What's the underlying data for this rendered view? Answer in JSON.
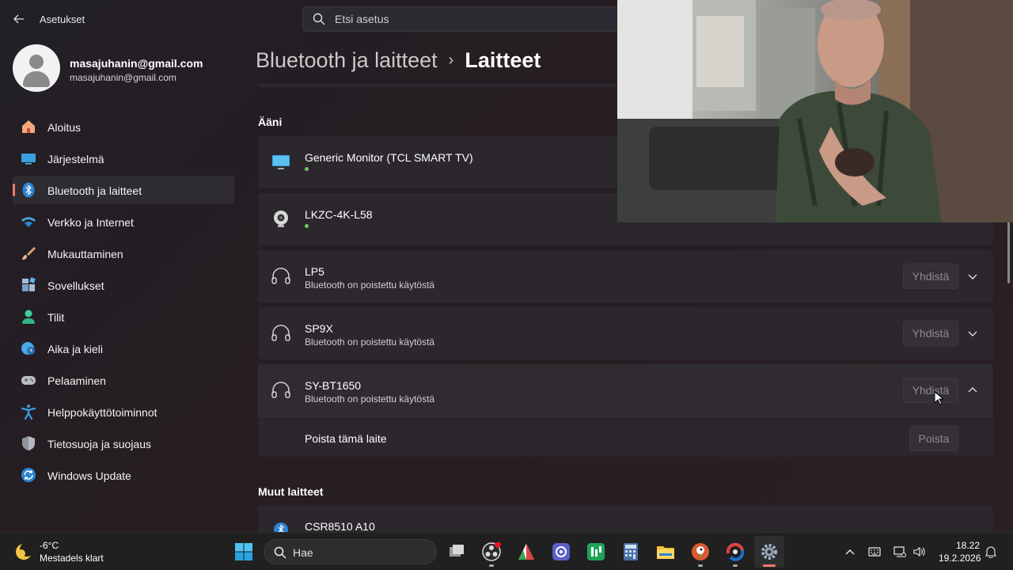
{
  "app": {
    "title": "Asetukset"
  },
  "search": {
    "placeholder": "Etsi asetus"
  },
  "profile": {
    "name": "masajuhanin@gmail.com",
    "email": "masajuhanin@gmail.com"
  },
  "sidebar": {
    "items": [
      {
        "label": "Aloitus",
        "icon": "home-icon"
      },
      {
        "label": "Järjestelmä",
        "icon": "system-icon"
      },
      {
        "label": "Bluetooth ja laitteet",
        "icon": "bluetooth-icon",
        "active": true
      },
      {
        "label": "Verkko ja Internet",
        "icon": "wifi-icon"
      },
      {
        "label": "Mukauttaminen",
        "icon": "brush-icon"
      },
      {
        "label": "Sovellukset",
        "icon": "apps-icon"
      },
      {
        "label": "Tilit",
        "icon": "account-icon"
      },
      {
        "label": "Aika ja kieli",
        "icon": "time-language-icon"
      },
      {
        "label": "Pelaaminen",
        "icon": "gamepad-icon"
      },
      {
        "label": "Helppokäyttötoiminnot",
        "icon": "accessibility-icon"
      },
      {
        "label": "Tietosuoja ja suojaus",
        "icon": "shield-icon"
      },
      {
        "label": "Windows Update",
        "icon": "update-icon"
      }
    ]
  },
  "breadcrumb": {
    "parent": "Bluetooth ja laitteet",
    "separator": "›",
    "current": "Laitteet"
  },
  "sections": {
    "audio": {
      "title": "Ääni",
      "devices": [
        {
          "name": "Generic Monitor (TCL SMART TV)",
          "status": "",
          "connected": true,
          "icon": "monitor-icon"
        },
        {
          "name": "LKZC-4K-L58",
          "status": "",
          "connected": true,
          "icon": "webcam-icon"
        },
        {
          "name": "LP5",
          "status": "Bluetooth on poistettu käytöstä",
          "button": "Yhdistä",
          "icon": "headset-icon"
        },
        {
          "name": "SP9X",
          "status": "Bluetooth on poistettu käytöstä",
          "button": "Yhdistä",
          "icon": "headset-icon"
        },
        {
          "name": "SY-BT1650",
          "status": "Bluetooth on poistettu käytöstä",
          "button": "Yhdistä",
          "icon": "headset-icon",
          "expanded": true
        }
      ],
      "expanded_panel": {
        "label": "Poista tämä laite",
        "button": "Poista"
      }
    },
    "other": {
      "title": "Muut laitteet",
      "devices": [
        {
          "name": "CSR8510 A10",
          "icon": "bluetooth-dongle-icon"
        }
      ]
    }
  },
  "taskbar": {
    "weather": {
      "temp": "-6°C",
      "desc": "Mestadels klart"
    },
    "search_label": "Hae",
    "clock": {
      "time": "18.22",
      "date": "19.2.2026"
    }
  },
  "colors": {
    "accent": "#f07a6a",
    "connected_dot": "#6ccb5f"
  }
}
